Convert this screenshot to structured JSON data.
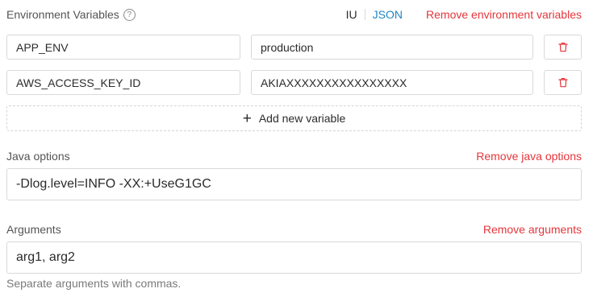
{
  "env_section": {
    "title": "Environment Variables",
    "help_icon": "question-circle-icon",
    "toggle": {
      "ui_label": "IU",
      "json_label": "JSON",
      "active": "JSON"
    },
    "remove_label": "Remove environment variables",
    "variables": [
      {
        "key": "APP_ENV",
        "value": "production"
      },
      {
        "key": "AWS_ACCESS_KEY_ID",
        "value": "AKIAXXXXXXXXXXXXXXXX"
      }
    ],
    "add_label": "Add new variable"
  },
  "java_section": {
    "title": "Java options",
    "remove_label": "Remove java options",
    "value": "-Dlog.level=INFO -XX:+UseG1GC"
  },
  "args_section": {
    "title": "Arguments",
    "remove_label": "Remove arguments",
    "value": "arg1, arg2",
    "hint": "Separate arguments with commas."
  },
  "colors": {
    "danger": "#e5363b",
    "link": "#1e87c8",
    "border": "#d9d9d9"
  }
}
